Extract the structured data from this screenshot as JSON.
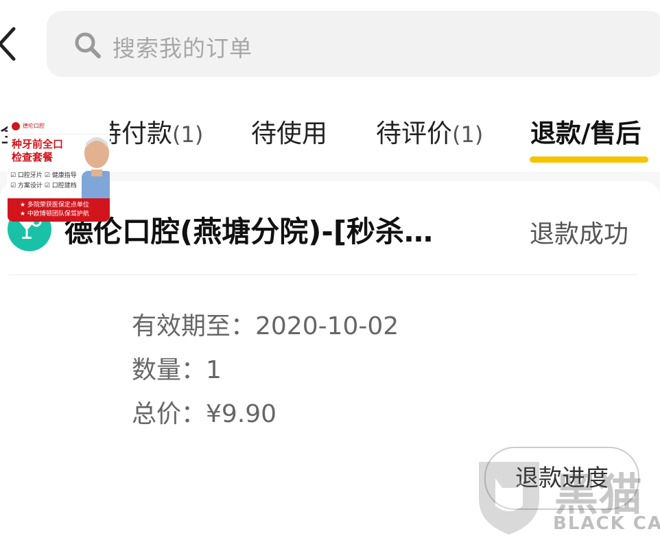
{
  "search": {
    "placeholder": "搜索我的订单"
  },
  "tabs": [
    {
      "label": "全部",
      "count": ""
    },
    {
      "label": "待付款",
      "count": "(1)"
    },
    {
      "label": "待使用",
      "count": ""
    },
    {
      "label": "待评价",
      "count": "(1)"
    },
    {
      "label": "退款/售后",
      "count": ""
    }
  ],
  "active_tab": "退款/售后",
  "colors": {
    "accent": "#f5c400",
    "store_icon": "#19c2a7",
    "thumb_red": "#d2141c"
  },
  "order": {
    "store_icon": "cocktail-icon",
    "store_name": "德伦口腔(燕塘分院)-[秒杀…",
    "status": "退款成功",
    "product_image": {
      "logo_text": "德伦口腔",
      "title": "种牙前全口\n检查套餐",
      "features": "☑ 口腔牙片  ☑ 健康指导\n☑ 方案设计  ☑ 口腔建档",
      "banner": "★ 多院荣获医保定点单位\n★ 中欧博顿团队保驾护航"
    },
    "validity": "有效期至：2020-10-02",
    "quantity": "数量：1",
    "total": "总价：¥9.90",
    "progress_button": "退款进度"
  },
  "watermark": {
    "cn": "黑猫",
    "en": "BLACK CAT"
  }
}
